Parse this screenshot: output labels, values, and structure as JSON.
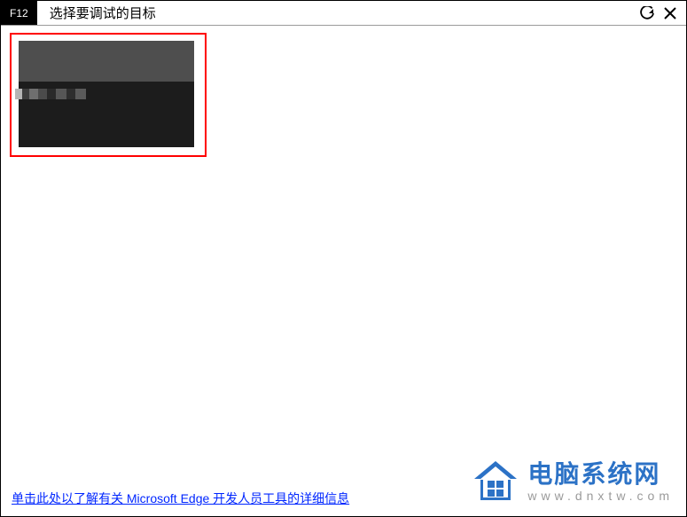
{
  "titlebar": {
    "badge": "F12",
    "title": "选择要调试的目标",
    "refresh_icon": "refresh",
    "close_icon": "close"
  },
  "footer": {
    "help_link": "单击此处以了解有关 Microsoft Edge 开发人员工具的详细信息"
  },
  "watermark": {
    "title": "电脑系统网",
    "url": "www.dnxtw.com"
  }
}
